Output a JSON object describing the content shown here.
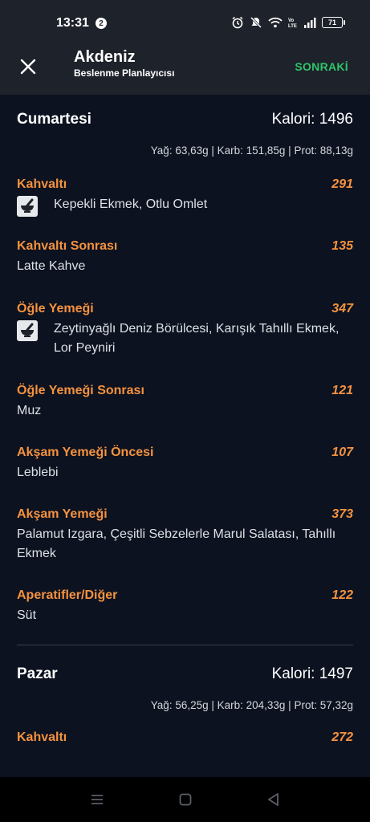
{
  "status": {
    "time": "13:31",
    "notification_count": "2",
    "battery": "71",
    "icons": [
      "alarm-icon",
      "mute-icon",
      "wifi-icon",
      "volte-icon",
      "signal-icon",
      "battery-icon"
    ]
  },
  "header": {
    "title": "Akdeniz",
    "subtitle": "Beslenme Planlayıcısı",
    "next_label": "SONRAKİ",
    "close_icon": "close-icon"
  },
  "colors": {
    "background": "#0c1220",
    "header": "#1e222a",
    "accent_orange": "#f5923e",
    "accent_green": "#2fc46a"
  },
  "days": [
    {
      "name": "Cumartesi",
      "calories": "Kalori: 1496",
      "macros": "Yağ: 63,63g | Karb: 151,85g | Prot: 88,13g",
      "meals": [
        {
          "name": "Kahvaltı",
          "kcal": "291",
          "desc": "Kepekli Ekmek, Otlu Omlet",
          "icon": "mortar-pestle-icon"
        },
        {
          "name": "Kahvaltı Sonrası",
          "kcal": "135",
          "desc": "Latte Kahve",
          "icon": ""
        },
        {
          "name": "Öğle Yemeği",
          "kcal": "347",
          "desc": "Zeytinyağlı Deniz Börülcesi, Karışık Tahıllı Ekmek, Lor Peyniri",
          "icon": "mortar-pestle-icon"
        },
        {
          "name": "Öğle Yemeği Sonrası",
          "kcal": "121",
          "desc": "Muz",
          "icon": ""
        },
        {
          "name": "Akşam Yemeği Öncesi",
          "kcal": "107",
          "desc": "Leblebi",
          "icon": ""
        },
        {
          "name": "Akşam Yemeği",
          "kcal": "373",
          "desc": "Palamut Izgara, Çeşitli Sebzelerle Marul Salatası, Tahıllı Ekmek",
          "icon": ""
        },
        {
          "name": "Aperatifler/Diğer",
          "kcal": "122",
          "desc": "Süt",
          "icon": ""
        }
      ]
    },
    {
      "name": "Pazar",
      "calories": "Kalori: 1497",
      "macros": "Yağ: 56,25g | Karb: 204,33g | Prot: 57,32g",
      "meals": [
        {
          "name": "Kahvaltı",
          "kcal": "272",
          "desc": "",
          "icon": ""
        }
      ]
    }
  ],
  "nav": {
    "icons": [
      "recent-apps-icon",
      "home-icon",
      "back-icon"
    ]
  }
}
